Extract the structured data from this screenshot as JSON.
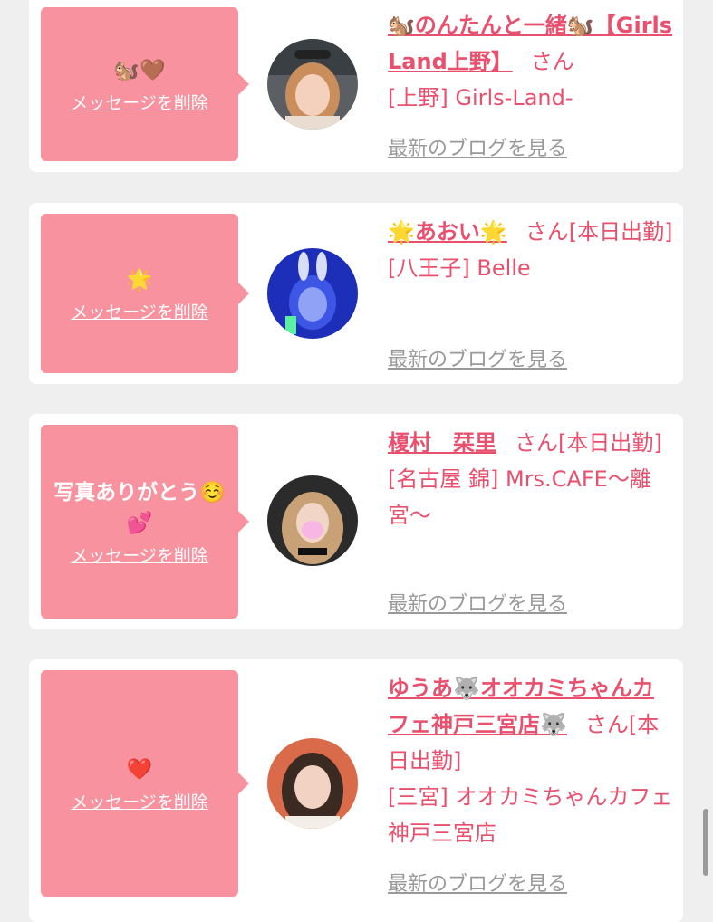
{
  "messages": [
    {
      "message": "🐿️🤎",
      "delete_label": "メッセージを削除",
      "name": "🐿️のんたんと一緒🐿️【Girls Land上野】",
      "honorific": "さん",
      "shop": "[上野] Girls-Land-",
      "blog_label": "最新のブログを見る"
    },
    {
      "message": "🌟",
      "delete_label": "メッセージを削除",
      "name": "🌟あおい🌟",
      "honorific": "さん[本日出勤]",
      "shop": "[八王子] Belle",
      "blog_label": "最新のブログを見る"
    },
    {
      "message": "写真ありがとう☺️💕",
      "delete_label": "メッセージを削除",
      "name": "榎村　栞里",
      "honorific": "さん[本日出勤]",
      "shop": "[名古屋 錦] Mrs.CAFE〜離宮〜",
      "blog_label": "最新のブログを見る"
    },
    {
      "message": "❤️",
      "delete_label": "メッセージを削除",
      "name": "ゆうあ🐺オオカミちゃんカフェ神戸三宮店🐺",
      "honorific": "さん[本日出勤]",
      "shop": "[三宮] オオカミちゃんカフェ神戸三宮店",
      "blog_label": "最新のブログを見る"
    }
  ],
  "colors": {
    "accent": "#e8506e",
    "bubble": "#f9929f",
    "muted": "#999999",
    "background": "#efefef"
  }
}
